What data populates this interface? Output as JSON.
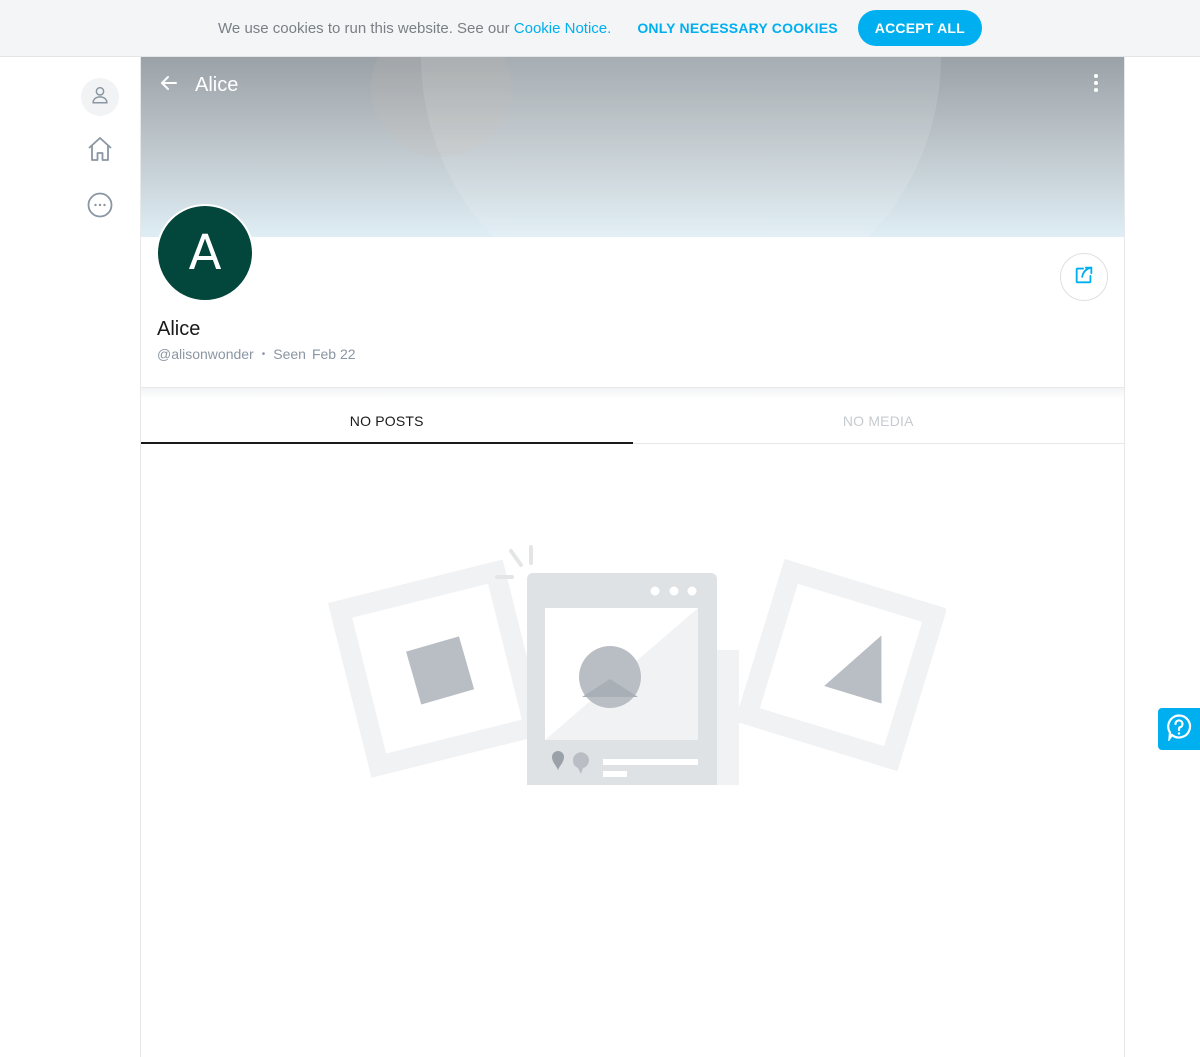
{
  "cookie_banner": {
    "text": "We use cookies to run this website. See our ",
    "link_label": "Cookie Notice.",
    "necessary_label": "ONLY NECESSARY COOKIES",
    "accept_label": "ACCEPT ALL"
  },
  "nav": {
    "items": [
      {
        "icon": "user-icon"
      },
      {
        "icon": "home-icon"
      },
      {
        "icon": "more-circle-icon"
      }
    ]
  },
  "profile": {
    "header_title": "Alice",
    "avatar_initial": "A",
    "name": "Alice",
    "username": "@alisonwonder",
    "seen_label": "Seen",
    "seen_date": "Feb 22",
    "avatar_color": "#03463c"
  },
  "tabs": [
    {
      "label": "NO POSTS",
      "active": true
    },
    {
      "label": "NO MEDIA",
      "active": false
    }
  ],
  "colors": {
    "accent": "#00aff0"
  }
}
